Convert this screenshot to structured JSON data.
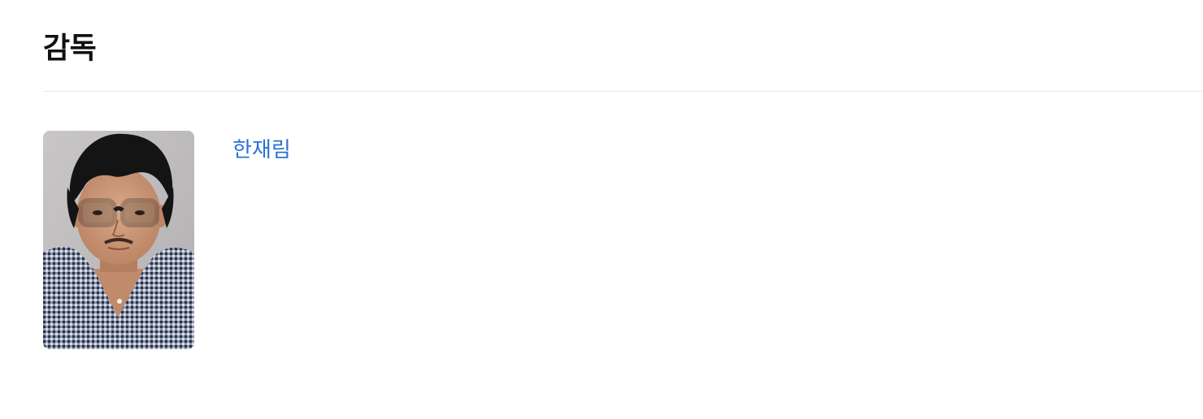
{
  "section": {
    "title": "감독"
  },
  "people": [
    {
      "name": "한재림",
      "photo_alt": "한재림"
    }
  ],
  "colors": {
    "link": "#2a73d4",
    "divider": "#e8e8e8",
    "title": "#111111"
  }
}
